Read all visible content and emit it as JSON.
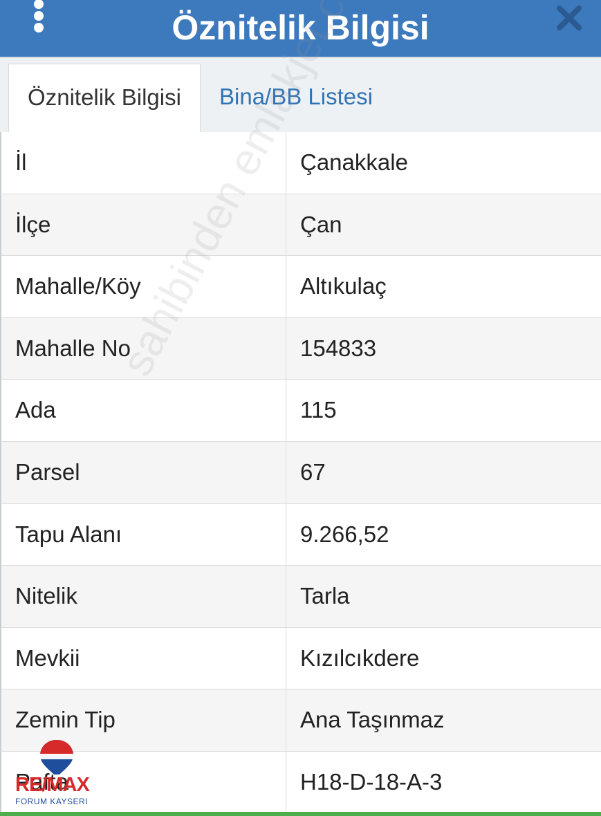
{
  "header": {
    "title": "Öznitelik Bilgisi",
    "menu_icon": "kebab-menu-icon",
    "close_icon": "close-icon",
    "color": "#3d79bd"
  },
  "tabs": [
    {
      "label": "Öznitelik Bilgisi",
      "active": true
    },
    {
      "label": "Bina/BB Listesi",
      "active": false
    }
  ],
  "rows": [
    {
      "label": "İl",
      "value": "Çanakkale"
    },
    {
      "label": "İlçe",
      "value": "Çan"
    },
    {
      "label": "Mahalle/Köy",
      "value": "Altıkulaç"
    },
    {
      "label": "Mahalle No",
      "value": "154833"
    },
    {
      "label": "Ada",
      "value": "115"
    },
    {
      "label": "Parsel",
      "value": "67"
    },
    {
      "label": "Tapu Alanı",
      "value": "9.266,52"
    },
    {
      "label": "Nitelik",
      "value": "Tarla"
    },
    {
      "label": "Mevkii",
      "value": "Kızılcıkdere"
    },
    {
      "label": "Zemin Tip",
      "value": "Ana Taşınmaz"
    },
    {
      "label": "Pafta",
      "value": "H18-D-18-A-3"
    }
  ],
  "watermark": "sahibinden emlakjet.com",
  "logo": {
    "name": "RE/MAX",
    "sub": "FORUM KAYSERI",
    "small": "RE/MAX"
  },
  "accent_bottom": "#4cae4c"
}
